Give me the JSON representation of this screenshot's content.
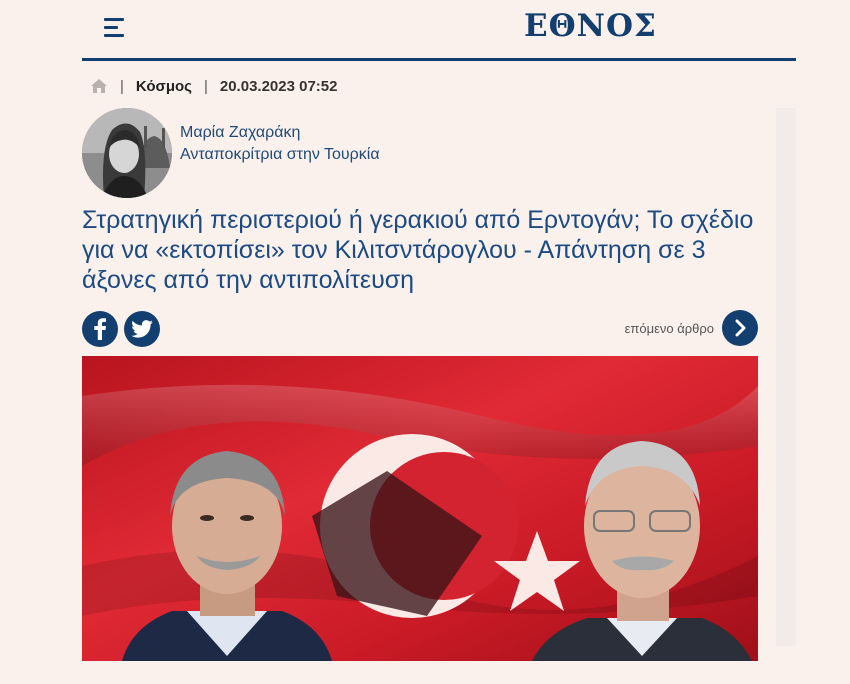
{
  "header": {
    "logo": "ΕΘΝΟΣ",
    "menu_icon": "hamburger-menu-icon",
    "brand_color": "#123f6f"
  },
  "breadcrumb": {
    "home_icon": "home-icon",
    "separator": "|",
    "category": "Κόσμος",
    "datetime": "20.03.2023 07:52"
  },
  "author": {
    "name": "Μαρία Ζαχαράκη",
    "role": "Ανταποκρίτρια στην Τουρκία"
  },
  "article": {
    "title": "Στρατηγική περιστεριού ή γερακιού από Ερντογάν; Το σχέδιο για να «εκτοπίσει» τον Κιλιτσντάρογλου - Απάντηση σε 3 άξονες από την αντιπολίτευση",
    "title_color": "#1c4a82"
  },
  "share": {
    "facebook_icon": "facebook-icon",
    "twitter_icon": "twitter-icon"
  },
  "next_article": {
    "label": "επόμενο άρθρο",
    "icon": "chevron-right-icon"
  },
  "hero_image": {
    "flag_color": "#d81e2c"
  }
}
